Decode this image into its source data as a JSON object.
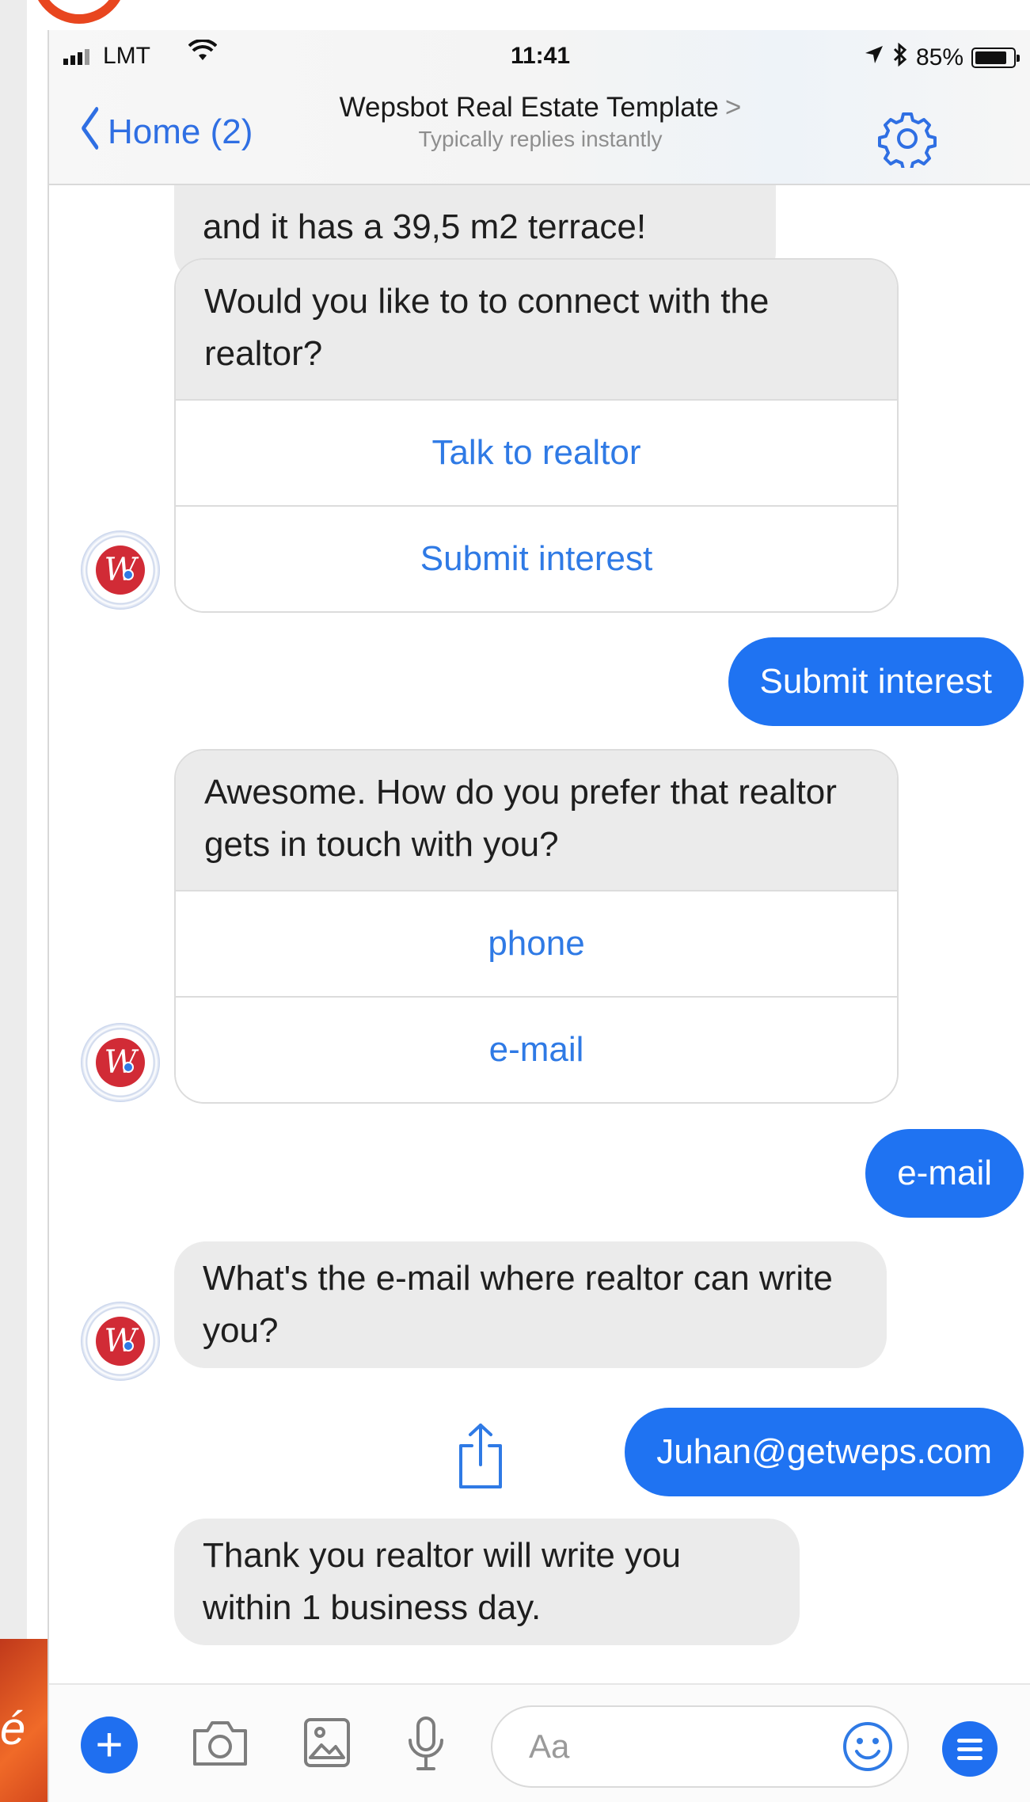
{
  "status_bar": {
    "carrier": "LMT",
    "time": "11:41",
    "battery": "85%"
  },
  "nav": {
    "back_label": "Home (2)",
    "title": "Wepsbot Real Estate Template",
    "title_arrow": ">",
    "subtitle": "Typically replies instantly"
  },
  "messages": {
    "partial_text": "and it has a  39,5 m2 terrace!",
    "card1": {
      "text": "Would you like to to connect with the realtor?",
      "buttons": [
        "Talk to realtor",
        "Submit interest"
      ]
    },
    "reply1": "Submit interest",
    "card2": {
      "text": "Awesome. How do you prefer that realtor gets in touch with you?",
      "buttons": [
        "phone",
        "e-mail"
      ]
    },
    "reply2": "e-mail",
    "question": "What's the e-mail where realtor can write you?",
    "reply3": "Juhan@getweps.com",
    "thanks": "Thank you realtor will write you within 1 business day.",
    "avatar_letter": "W"
  },
  "composer": {
    "placeholder": "Aa",
    "plus_symbol": "+"
  },
  "decor": {
    "slide_letter": "é"
  },
  "colors": {
    "accent": "#1f73f2",
    "link": "#2f7ae5",
    "bot_bubble": "#ebebeb",
    "avatar_red": "#d12b36"
  },
  "icons": [
    "signal-icon",
    "wifi-icon",
    "location-icon",
    "bluetooth-icon",
    "battery-icon",
    "chevron-left-icon",
    "gear-icon",
    "share-icon",
    "plus-icon",
    "camera-icon",
    "image-icon",
    "microphone-icon",
    "emoji-icon",
    "menu-icon"
  ]
}
